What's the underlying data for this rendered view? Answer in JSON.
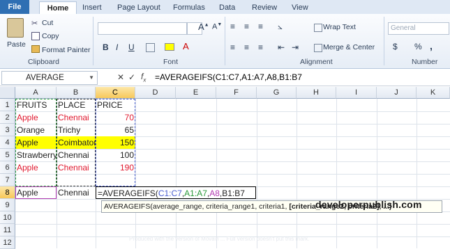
{
  "ribbon_tabs": [
    "File",
    "Home",
    "Insert",
    "Page Layout",
    "Formulas",
    "Data",
    "Review",
    "View"
  ],
  "clipboard": {
    "paste": "Paste",
    "cut": "Cut",
    "copy": "Copy",
    "format_painter": "Format Painter",
    "label": "Clipboard"
  },
  "font_group": {
    "label": "Font",
    "bold": "B",
    "italic": "I",
    "underline": "U"
  },
  "alignment_group": {
    "label": "Alignment",
    "wrap_text": "Wrap Text",
    "merge_center": "Merge & Center"
  },
  "number_group": {
    "label": "Number",
    "format": "General",
    "currency": "$",
    "percent": "%",
    "comma": ","
  },
  "formula_bar": {
    "name_box": "AVERAGE",
    "formula": "=AVERAGEIFS(C1:C7,A1:A7,A8,B1:B7"
  },
  "columns": [
    "A",
    "B",
    "C",
    "D",
    "E",
    "F",
    "G",
    "H",
    "I",
    "J",
    "K"
  ],
  "rows": [
    "1",
    "2",
    "3",
    "4",
    "5",
    "6",
    "7",
    "8",
    "9",
    "10",
    "11",
    "12"
  ],
  "cells": {
    "A1": "FRUITS",
    "B1": "PLACE",
    "C1": "PRICE",
    "A2": "Apple",
    "B2": "Chennai",
    "C2": "70",
    "A3": "Orange",
    "B3": "Trichy",
    "C3": "65",
    "A4": "Apple",
    "B4": "Coimbatore",
    "C4": "150",
    "A5": "Strawberry",
    "B5": "Chennai",
    "C5": "100",
    "A6": "Apple",
    "B6": "Chennai",
    "C6": "190",
    "A8": "Apple",
    "B8": "Chennai",
    "C8_prefix": "=AVERAGEIFS(",
    "C8_r1": "C1:C7",
    ",": "",
    "C8_r2": "A1:A7",
    "C8_r3": "A8",
    "C8_r4": "B1:B7"
  },
  "tooltip": {
    "fn": "AVERAGEIFS(average_range, criteria_range1, criteria1, ",
    "bold": "[criteria_range2, criteria2], ...)"
  },
  "watermark": "developerpublish.com",
  "footnote": "Produced with the version of Movavi ... Full version doesn't put this mark.",
  "colors": {
    "range1": "#4a5fd1",
    "range2": "#2a9a3a",
    "range3": "#b23ab2",
    "range4": "#c0392b",
    "highlight": "#ffff00",
    "red_text": "#e0182e"
  }
}
